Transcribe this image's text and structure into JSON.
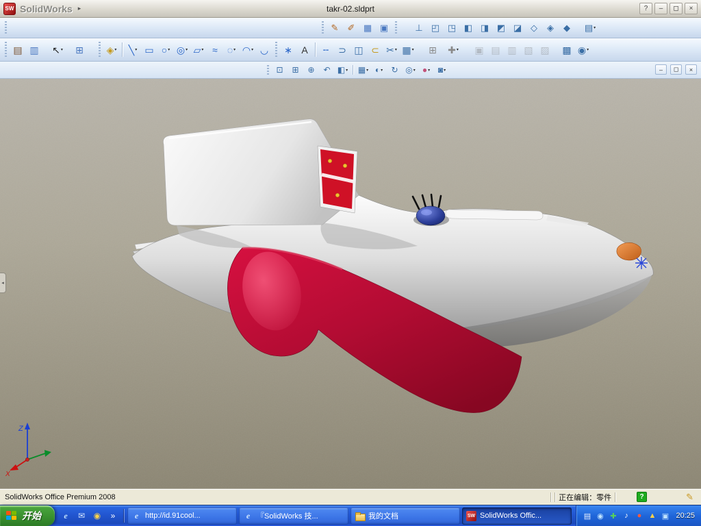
{
  "colors": {
    "taskbar_blue": "#2257d2",
    "start_green": "#3c9431",
    "toolbar_blue": "#dde9f7",
    "statusbar_bg": "#ece9d8",
    "viewport_top": "#b9b5ab",
    "viewport_bottom": "#8c8673",
    "model_body_silver": "#dedede",
    "model_crimson": "#b30c33",
    "model_dome_blue": "#2b3d98",
    "model_winglet_orange": "#e07b35",
    "model_decal_red": "#cf1126"
  },
  "titlebar": {
    "logo_text": "SW",
    "app_name": "SolidWorks",
    "menu_arrow": "▸",
    "doc_title": "takr-02.sldprt",
    "help": "?",
    "minimize": "–",
    "maximize": "◻",
    "close": "×"
  },
  "doc_window": {
    "minimize": "–",
    "restore": "◻",
    "close": "×"
  },
  "toolbars": {
    "standard": [
      {
        "grip": true
      },
      {
        "sp": 452
      },
      {
        "grip": true
      },
      {
        "n": "sketch",
        "g": "✎",
        "c": "#b3661e"
      },
      {
        "n": "3d-sketch",
        "g": "✐",
        "c": "#b3661e"
      },
      {
        "n": "reference-geometry",
        "g": "▦",
        "c": "#4a78c0"
      },
      {
        "n": "instant-3d",
        "g": "▣",
        "c": "#4a78c0"
      },
      {
        "grip": true
      },
      {
        "sp": 16
      },
      {
        "n": "normal-to",
        "g": "⊥",
        "c": "#3a6ea5"
      },
      {
        "n": "front-view",
        "g": "◰",
        "c": "#3a6ea5"
      },
      {
        "n": "back-view",
        "g": "◳",
        "c": "#3a6ea5"
      },
      {
        "n": "left-view",
        "g": "◧",
        "c": "#3a6ea5"
      },
      {
        "n": "right-view",
        "g": "◨",
        "c": "#3a6ea5"
      },
      {
        "n": "top-view",
        "g": "◩",
        "c": "#3a6ea5"
      },
      {
        "n": "bottom-view",
        "g": "◪",
        "c": "#3a6ea5"
      },
      {
        "n": "isometric-view",
        "g": "◇",
        "c": "#3a6ea5"
      },
      {
        "n": "trimetric-view",
        "g": "◈",
        "c": "#3a6ea5"
      },
      {
        "n": "dimetric-view",
        "g": "◆",
        "c": "#3a6ea5"
      },
      {
        "sp": 10
      },
      {
        "n": "view-orientation",
        "g": "▤",
        "c": "#3a6ea5",
        "dd": true
      }
    ],
    "sketch": [
      {
        "grip": true
      },
      {
        "n": "line-format",
        "g": "▤",
        "c": "#7a5230"
      },
      {
        "n": "layer-properties",
        "g": "▥",
        "c": "#4a78c0"
      },
      {
        "sp": 10
      },
      {
        "n": "select",
        "g": "↖",
        "c": "#222222",
        "dd": true
      },
      {
        "sp": 8
      },
      {
        "n": "selection-filter",
        "g": "⊞",
        "c": "#4a78c0"
      },
      {
        "sp": 12
      },
      {
        "grip": true
      },
      {
        "n": "smart-dimension",
        "g": "◈",
        "c": "#c59a1e",
        "dd": true
      },
      {
        "sep": true
      },
      {
        "n": "line",
        "g": "╲",
        "c": "#2a66c8",
        "dd": true
      },
      {
        "n": "corner-rectangle",
        "g": "▭",
        "c": "#2a66c8"
      },
      {
        "n": "circle",
        "g": "○",
        "c": "#2a66c8",
        "dd": true
      },
      {
        "n": "perimeter-circle",
        "g": "◎",
        "c": "#2a66c8",
        "dd": true
      },
      {
        "n": "parallelogram",
        "g": "▱",
        "c": "#2a66c8",
        "dd": true
      },
      {
        "n": "spline",
        "g": "≈",
        "c": "#2a66c8"
      },
      {
        "n": "ellipse",
        "g": "◌",
        "c": "#2a66c8",
        "dd": true
      },
      {
        "n": "centerpoint-arc",
        "g": "◠",
        "c": "#2a66c8",
        "dd": true
      },
      {
        "n": "tangent-arc",
        "g": "◡",
        "c": "#2a66c8"
      },
      {
        "grip": true
      },
      {
        "n": "point",
        "g": "∗",
        "c": "#2a66c8"
      },
      {
        "n": "text",
        "g": "A",
        "c": "#333333"
      },
      {
        "sep": true
      },
      {
        "n": "centerline",
        "g": "╌",
        "c": "#2a66c8"
      },
      {
        "n": "convert-entities",
        "g": "⊃",
        "c": "#3a6ea5"
      },
      {
        "n": "mirror-entities",
        "g": "◫",
        "c": "#3a6ea5"
      },
      {
        "n": "offset-entities",
        "g": "⊂",
        "c": "#c59a1e"
      },
      {
        "n": "trim-entities",
        "g": "✂",
        "c": "#3a6ea5",
        "dd": true
      },
      {
        "n": "linear-sketch-pattern",
        "g": "▦",
        "c": "#3a6ea5",
        "dd": true
      },
      {
        "sp": 12
      },
      {
        "n": "grid",
        "g": "⊞",
        "c": "#8a8a8a"
      },
      {
        "sp": 6
      },
      {
        "n": "quick-snaps",
        "g": "✚",
        "c": "#8a8a8a",
        "dd": true
      },
      {
        "sp": 14
      },
      {
        "n": "make-block",
        "g": "▣",
        "c": "#777777",
        "dis": true
      },
      {
        "n": "edit-block",
        "g": "▤",
        "c": "#777777",
        "dis": true
      },
      {
        "n": "insert-block",
        "g": "▥",
        "c": "#777777",
        "dis": true
      },
      {
        "n": "add-to-library",
        "g": "▧",
        "c": "#777777",
        "dis": true
      },
      {
        "n": "explode-block",
        "g": "▨",
        "c": "#777777",
        "dis": true
      },
      {
        "sp": 8
      },
      {
        "n": "sketch-picture",
        "g": "▩",
        "c": "#3a6ea5"
      },
      {
        "n": "sketch-settings",
        "g": "◉",
        "c": "#3a6ea5",
        "dd": true
      }
    ],
    "view": [
      {
        "grip": true
      },
      {
        "n": "zoom-to-fit",
        "g": "⊡",
        "c": "#3a6ea5"
      },
      {
        "n": "zoom-to-area",
        "g": "⊞",
        "c": "#3a6ea5"
      },
      {
        "n": "zoom-in-out",
        "g": "⊕",
        "c": "#3a6ea5"
      },
      {
        "n": "previous-view",
        "g": "↶",
        "c": "#3a6ea5"
      },
      {
        "n": "section-view",
        "g": "◧",
        "c": "#3a6ea5",
        "dd": true
      },
      {
        "sep": true
      },
      {
        "n": "view-orientation",
        "g": "▦",
        "c": "#3a6ea5",
        "dd": true
      },
      {
        "n": "display-style",
        "g": "◐",
        "c": "#3a6ea5",
        "dd": true
      },
      {
        "n": "rotate-view",
        "g": "↻",
        "c": "#3a6ea5"
      },
      {
        "n": "hide-show-items",
        "g": "◎",
        "c": "#3a6ea5",
        "dd": true
      },
      {
        "n": "edit-appearance",
        "g": "●",
        "c": "#c2527a",
        "dd": true
      },
      {
        "n": "apply-scene",
        "g": "◙",
        "c": "#3a6ea5",
        "dd": true
      }
    ]
  },
  "viewport": {
    "collapse_arrow": "◂",
    "triad": {
      "x": "X",
      "z": "Z"
    }
  },
  "statusbar": {
    "product": "SolidWorks Office Premium 2008",
    "editing": "正在编辑：零件",
    "help_badge": "?",
    "pencil": "✎"
  },
  "taskbar": {
    "start_label": "开始",
    "quick_launch": [
      {
        "n": "internet-explorer",
        "g": "e",
        "c": "#bfe0ff",
        "serif": true
      },
      {
        "n": "outlook-express",
        "g": "✉",
        "c": "#d6e8ff"
      },
      {
        "n": "media-player",
        "g": "◉",
        "c": "#ffd24a"
      },
      {
        "n": "more-buttons-chevron",
        "g": "»",
        "c": "#ffffff"
      }
    ],
    "tasks": [
      {
        "label": "http://id.91cool...",
        "icon": "ie"
      },
      {
        "label": "『SolidWorks 技...",
        "icon": "ie"
      },
      {
        "label": "我的文档",
        "icon": "folder"
      },
      {
        "label": "SolidWorks Offic...",
        "icon": "solidworks",
        "active": true
      }
    ],
    "tray_icons": [
      {
        "n": "input-method",
        "g": "▤",
        "c": "#eaf2ff"
      },
      {
        "n": "messenger",
        "g": "◉",
        "c": "#bfe3ff"
      },
      {
        "n": "antivirus",
        "g": "✚",
        "c": "#57d05c"
      },
      {
        "n": "volume",
        "g": "♪",
        "c": "#ffffff"
      },
      {
        "n": "security-alert",
        "g": "●",
        "c": "#ff5a3c"
      },
      {
        "n": "shield",
        "g": "▲",
        "c": "#ffd24a"
      },
      {
        "n": "network",
        "g": "▣",
        "c": "#bfe3ff"
      }
    ],
    "clock": "20:25"
  }
}
